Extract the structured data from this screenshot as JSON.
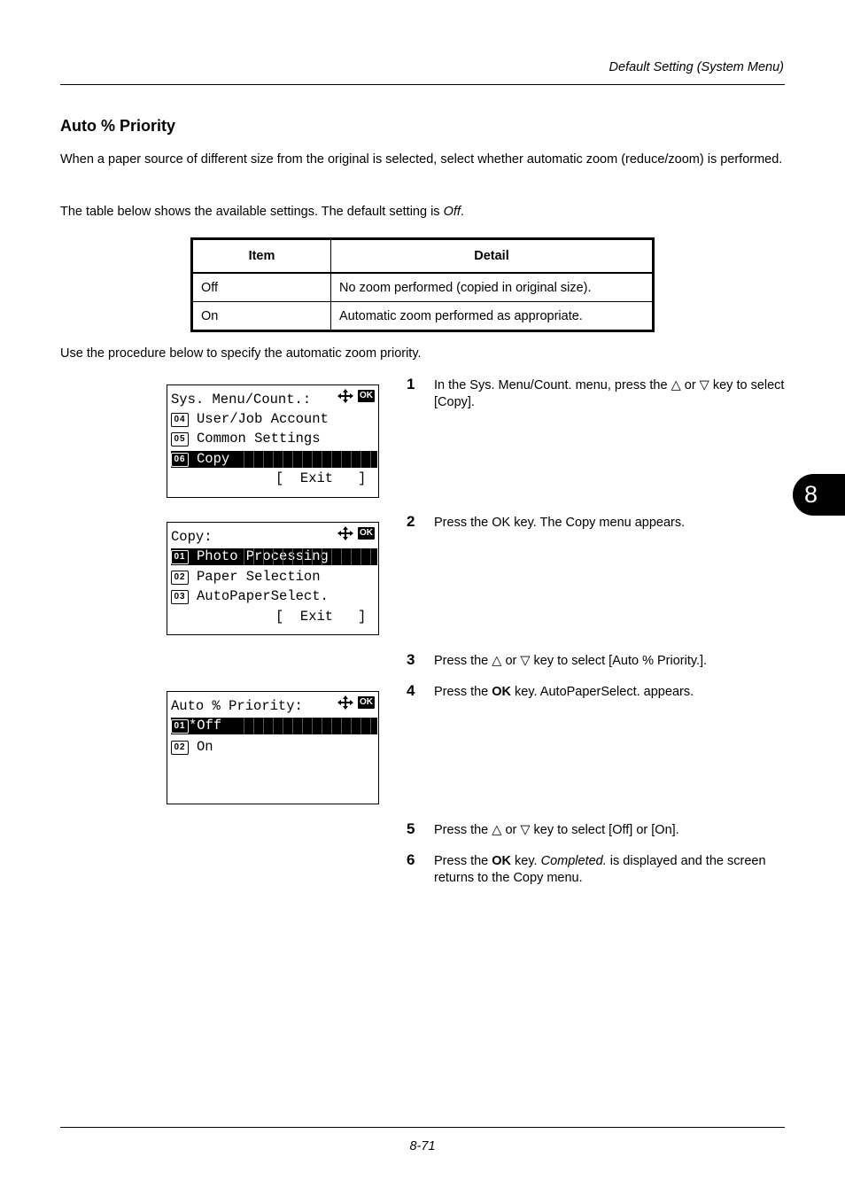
{
  "header": {
    "running_title": "Default Setting (System Menu)"
  },
  "section": {
    "title": "Auto % Priority",
    "intro": "When a paper source of different size from the original is selected, select whether automatic zoom (reduce/zoom) is performed.",
    "table_intro_prefix": "The table below shows the available settings. The default setting is ",
    "table_intro_default": "Off",
    "table_intro_suffix": ".",
    "procedure_intro": "Use the procedure below to specify the automatic zoom priority."
  },
  "table": {
    "headers": [
      "Item",
      "Detail"
    ],
    "rows": [
      [
        "Off",
        "No zoom performed (copied in original size)."
      ],
      [
        "On",
        "Automatic zoom performed as appropriate."
      ]
    ]
  },
  "screens": [
    {
      "title": "Sys. Menu/Count.:",
      "lines": [
        {
          "num": "04",
          "text": "User/Job Account",
          "selected": false
        },
        {
          "num": "05",
          "text": "Common Settings",
          "selected": false
        },
        {
          "num": "06",
          "text": "Copy",
          "selected": true
        }
      ],
      "footer": "[  Exit   ]"
    },
    {
      "title": "Copy:",
      "lines": [
        {
          "num": "01",
          "text": "Photo Processing",
          "selected": true
        },
        {
          "num": "02",
          "text": "Paper Selection",
          "selected": false
        },
        {
          "num": "03",
          "text": "AutoPaperSelect.",
          "selected": false
        }
      ],
      "footer": "[  Exit   ]"
    },
    {
      "title": "Auto % Priority:",
      "lines": [
        {
          "num": "01",
          "text": "*Off",
          "selected": true
        },
        {
          "num": "02",
          "text": "On",
          "selected": false
        }
      ],
      "footer": ""
    }
  ],
  "icons": {
    "nav": "four-way-arrow-icon",
    "ok": "OK"
  },
  "steps": [
    {
      "num": "1",
      "parts": [
        "In the Sys. Menu/Count. menu, press the △ or ▽ key to select [Copy]."
      ]
    },
    {
      "num": "2",
      "parts": [
        "Press the OK key. The Copy menu appears."
      ]
    },
    {
      "num": "3",
      "parts": [
        "Press the △ or ▽ key to select [Auto % Priority.]."
      ]
    },
    {
      "num": "4",
      "pre": "Press the ",
      "bold": "OK",
      "post": " key. AutoPaperSelect. appears."
    },
    {
      "num": "5",
      "parts": [
        "Press the △ or ▽ key to select [Off] or [On]."
      ]
    },
    {
      "num": "6",
      "pre": "Press the ",
      "bold": "OK",
      "mid": " key. ",
      "italic": "Completed.",
      "post": " is displayed and the screen returns to the Copy menu."
    }
  ],
  "chapter_tab": "8",
  "footer": {
    "page_number": "8-71"
  }
}
